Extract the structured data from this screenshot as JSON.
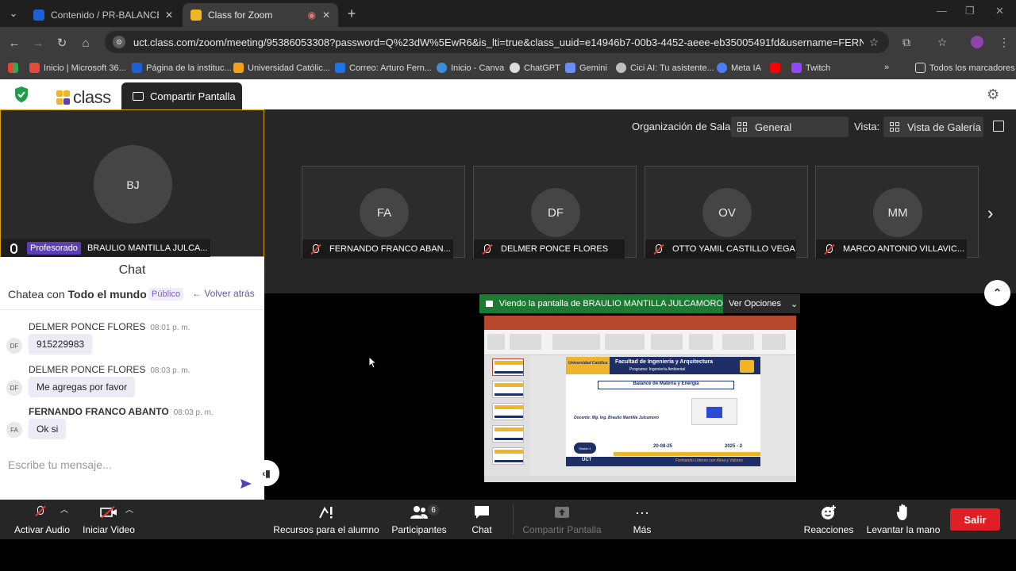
{
  "browser": {
    "tabs": [
      {
        "title": "Contenido / PR-BALANCE DE M",
        "favicon_color": "#1e5fd6",
        "active": false
      },
      {
        "title": "Class for Zoom",
        "favicon_color": "#f0b429",
        "active": true
      }
    ],
    "url": "uct.class.com/zoom/meeting/95386053308?password=Q%23dW%5EwR6&is_lti=true&class_uuid=e14946b7-00b3-4452-aeee-eb35005491fd&username=FERNANDO+FRANCO+...",
    "bookmarks": [
      {
        "label": "Inicio | Microsoft 36...",
        "color": "#e24a3a"
      },
      {
        "label": "Página de la instituc...",
        "color": "#1e5fd6"
      },
      {
        "label": "Universidad Católic...",
        "color": "#f0a020"
      },
      {
        "label": "Correo: Arturo Fern...",
        "color": "#1e73e8"
      },
      {
        "label": "Inicio - Canva",
        "color": "#3f8fd8"
      },
      {
        "label": "ChatGPT",
        "color": "#dddddd"
      },
      {
        "label": "Gemini",
        "color": "#6d8cf5"
      },
      {
        "label": "Cici AI: Tu asistente...",
        "color": "#c0c0c0"
      },
      {
        "label": "Meta IA",
        "color": "#4a7dff"
      },
      {
        "label": "",
        "color": "#ff0000"
      },
      {
        "label": "Twitch",
        "color": "#9146ff"
      }
    ],
    "all_bookmarks": "Todos los marcadores"
  },
  "app": {
    "logo_text": "class",
    "share_tab": "Compartir Pantalla"
  },
  "host": {
    "initials": "BJ",
    "role": "Profesorado",
    "name": "BRAULIO MANTILLA JULCA..."
  },
  "chat": {
    "title": "Chat",
    "scope_prefix": "Chatea con ",
    "scope": "Todo el mundo",
    "public_badge": "Público",
    "back": "Volver atrás",
    "messages": [
      {
        "initials": "DF",
        "name": "DELMER PONCE FLORES",
        "time": "08:01 p. m.",
        "text": "915229983",
        "bold": false
      },
      {
        "initials": "DF",
        "name": "DELMER PONCE FLORES",
        "time": "08:03 p. m.",
        "text": "Me agregas por favor",
        "bold": false
      },
      {
        "initials": "FA",
        "name": "FERNANDO FRANCO ABANTO",
        "time": "08:03 p. m.",
        "text": "Ok si",
        "bold": true
      }
    ],
    "input_placeholder": "Escribe tu mensaje..."
  },
  "room": {
    "org_label": "Organización de Sala:",
    "org_value": "General",
    "view_label": "Vista:",
    "view_value": "Vista de Galería"
  },
  "participants": [
    {
      "initials": "FA",
      "name": "FERNANDO FRANCO ABAN..."
    },
    {
      "initials": "DF",
      "name": "DELMER PONCE FLORES"
    },
    {
      "initials": "OV",
      "name": "OTTO YAMIL CASTILLO VEGA"
    },
    {
      "initials": "MM",
      "name": "MARCO ANTONIO VILLAVIC..."
    }
  ],
  "share": {
    "banner": "Viendo la pantalla de BRAULIO MANTILLA JULCAMORO",
    "options": "Ver Opciones",
    "slide": {
      "university": "Universidad Católica",
      "faculty": "Facultad de Ingeniería y Arquitectura",
      "program": "Programa: Ingeniería Ambiental",
      "course": "Balance de Materia y Energía",
      "teacher": "Docente: Mg. Ing. Braulio Mantilla Julcamoro",
      "session": "Sesión 1",
      "date": "20-08-25",
      "term": "2025 - 2",
      "institution": "UCT",
      "motto": "Formando Líderes con Alma y Valores"
    }
  },
  "toolbar": {
    "audio": "Activar Audio",
    "video": "Iniciar Video",
    "resources": "Recursos para el alumno",
    "participants": "Participantes",
    "participants_count": "6",
    "chat": "Chat",
    "share": "Compartir Pantalla",
    "more": "Más",
    "reactions": "Reacciones",
    "raise_hand": "Levantar la mano",
    "leave": "Salir"
  },
  "colors": {
    "accent_yellow": "#f0b429",
    "leave_red": "#e01e25",
    "share_green": "#1e7a32",
    "role_purple": "#5a3fb5"
  }
}
